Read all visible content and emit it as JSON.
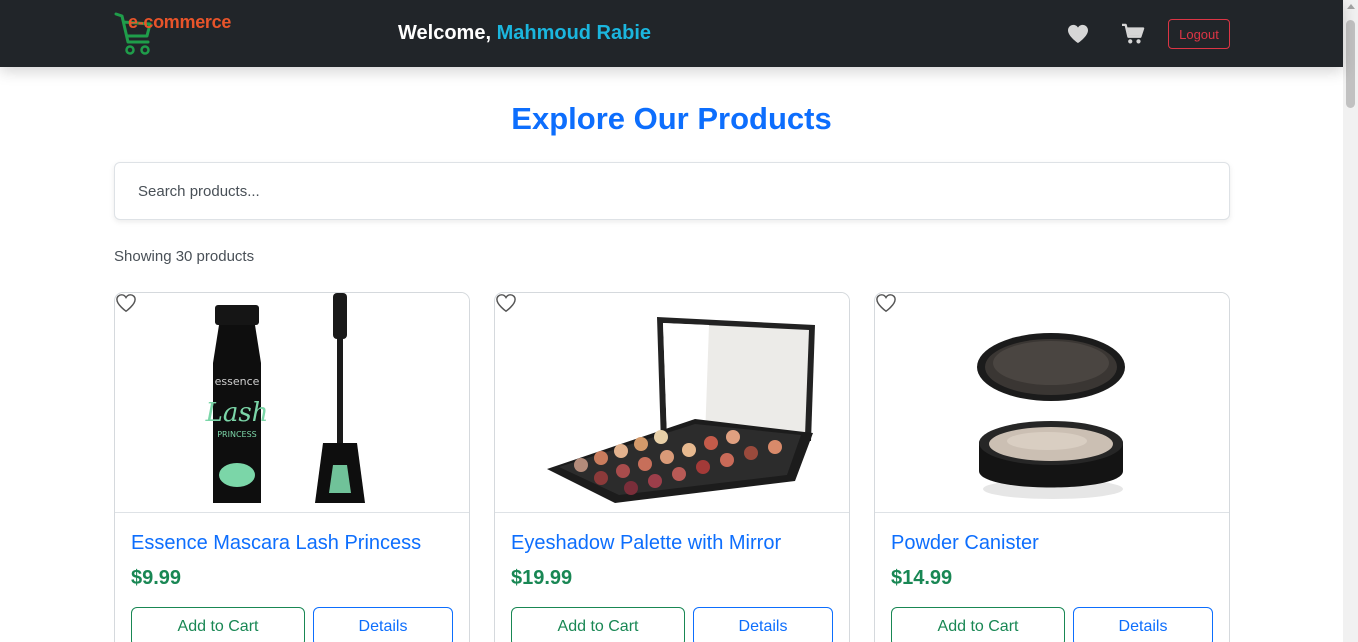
{
  "header": {
    "logo_text": "e-commerce",
    "welcome_prefix": "Welcome,",
    "user_name": "Mahmoud Rabie",
    "logout_label": "Logout",
    "icons": {
      "wishlist": "heart-icon",
      "cart": "cart-icon"
    }
  },
  "main": {
    "title": "Explore Our Products",
    "search_placeholder": "Search products...",
    "showing_text": "Showing 30 products"
  },
  "products": [
    {
      "title": "Essence Mascara Lash Princess",
      "price": "$9.99",
      "add_to_cart": "Add to Cart",
      "details": "Details",
      "image": "mascara"
    },
    {
      "title": "Eyeshadow Palette with Mirror",
      "price": "$19.99",
      "add_to_cart": "Add to Cart",
      "details": "Details",
      "image": "eyeshadow-palette"
    },
    {
      "title": "Powder Canister",
      "price": "$14.99",
      "add_to_cart": "Add to Cart",
      "details": "Details",
      "image": "powder-canister"
    }
  ],
  "colors": {
    "navbar": "#212529",
    "primary": "#0d6efd",
    "price": "#198754",
    "danger": "#dc3545",
    "user_accent": "#1bb6de",
    "logo": "#e8542a"
  }
}
